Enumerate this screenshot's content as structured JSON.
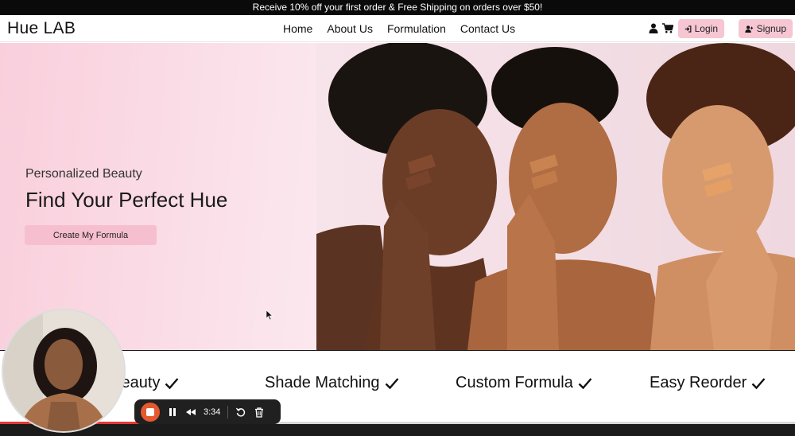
{
  "promo": {
    "text": "Receive 10% off your first order & Free Shipping on orders over $50!"
  },
  "nav": {
    "logo_bold": "Hue",
    "logo_light": "LAB",
    "links": [
      "Home",
      "About Us",
      "Formulation",
      "Contact Us"
    ],
    "login_label": "Login",
    "signup_label": "Signup"
  },
  "hero": {
    "subtitle": "Personalized Beauty",
    "title": "Find Your Perfect Hue",
    "cta_label": "Create My Formula",
    "image_alt": "three-women-with-foundation-swatches"
  },
  "features": [
    "Personalized Beauty",
    "Shade Matching",
    "Custom Formula",
    "Easy Reorder"
  ],
  "recorder": {
    "time": "3:34",
    "progress": 0.28
  },
  "colors": {
    "accent_pink": "#f6c6d3",
    "promo_bg": "#0a0a0a",
    "record_red": "#e4592f"
  },
  "icons": [
    "user-icon",
    "cart-icon",
    "login-icon",
    "user-plus-icon",
    "checkmark-icon",
    "stop-icon",
    "pause-icon",
    "rewind-icon",
    "restart-icon",
    "trash-icon",
    "cursor-icon"
  ]
}
